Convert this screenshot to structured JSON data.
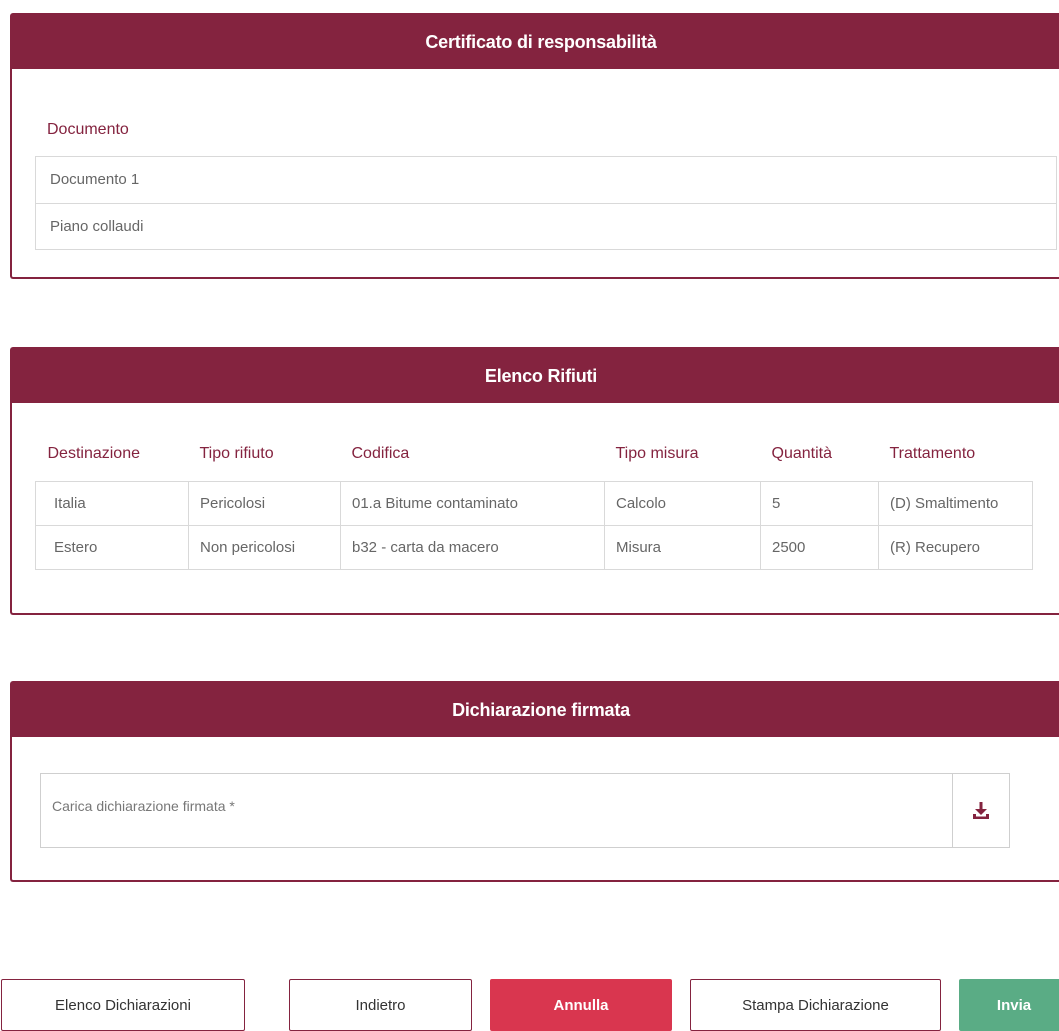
{
  "certificate": {
    "title": "Certificato di responsabilità",
    "section_label": "Documento",
    "documents": [
      "Documento 1",
      "Piano collaudi"
    ]
  },
  "waste": {
    "title": "Elenco Rifiuti",
    "columns": [
      "Destinazione",
      "Tipo rifiuto",
      "Codifica",
      "Tipo misura",
      "Quantità",
      "Trattamento"
    ],
    "rows": [
      [
        "Italia",
        "Pericolosi",
        "01.a Bitume contaminato",
        "Calcolo",
        "5",
        "(D) Smaltimento"
      ],
      [
        "Estero",
        "Non pericolosi",
        "b32 - carta da macero",
        "Misura",
        "2500",
        "(R) Recupero"
      ]
    ]
  },
  "declaration": {
    "title": "Dichiarazione firmata",
    "upload_placeholder": "Carica dichiarazione firmata *",
    "upload_icon": "download-icon"
  },
  "actions": {
    "elenco_label": "Elenco Dichiarazioni",
    "indietro_label": "Indietro",
    "annulla_label": "Annulla",
    "stampa_label": "Stampa Dichiarazione",
    "invia_label": "Invia"
  },
  "colors": {
    "brand": "#84233f",
    "danger": "#d9364f",
    "success": "#5aac85"
  }
}
